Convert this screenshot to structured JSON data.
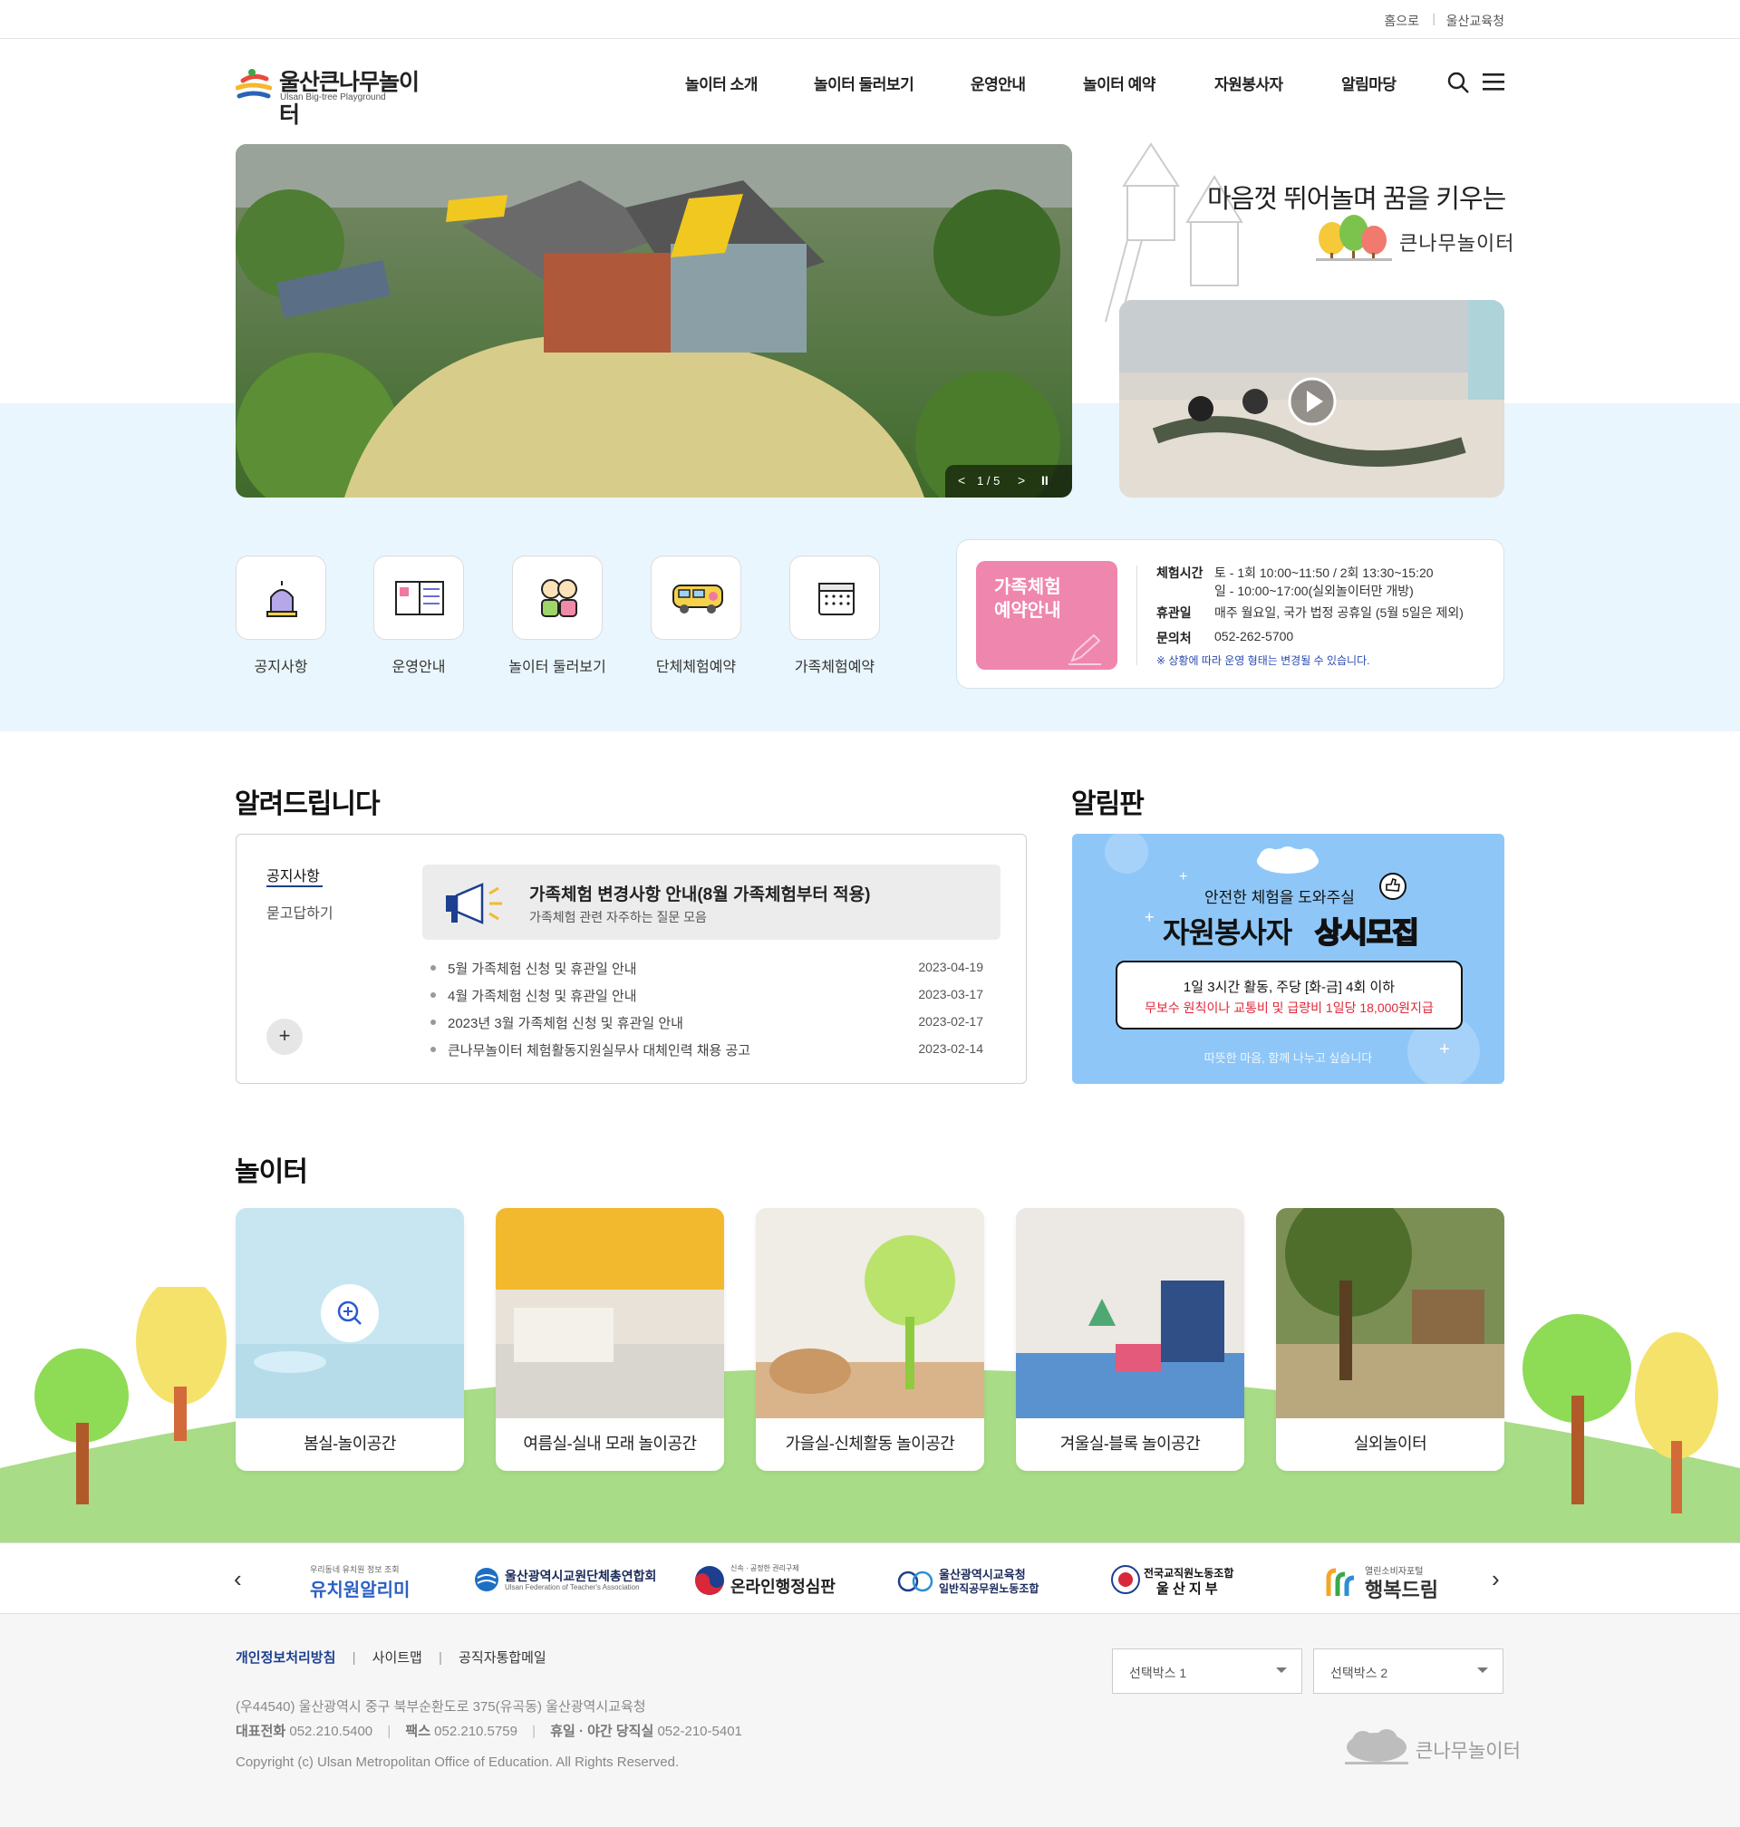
{
  "util": {
    "home": "홈으로",
    "ulsan": "울산교육청"
  },
  "logo": {
    "name": "울산큰나무놀이터",
    "sub": "Ulsan Big-tree Playground"
  },
  "gnb": [
    "놀이터 소개",
    "놀이터 둘러보기",
    "운영안내",
    "놀이터 예약",
    "자원봉사자",
    "알림마당"
  ],
  "hero": {
    "counter": "1 / 5"
  },
  "slogan": {
    "line": "마음껏 뛰어놀며 꿈을 키우는",
    "brand": "큰나무놀이터"
  },
  "quick": [
    "공지사항",
    "운영안내",
    "놀이터 둘러보기",
    "단체체험예약",
    "가족체험예약"
  ],
  "info": {
    "title1": "가족체험",
    "title2": "예약안내",
    "time_label": "체험시간",
    "time1": "토 - 1회 10:00~11:50 / 2회 13:30~15:20",
    "time2": "일 - 10:00~17:00(실외놀이터만 개방)",
    "closed_label": "휴관일",
    "closed": "매주 월요일, 국가 법정 공휴일 (5월 5일은 제외)",
    "contact_label": "문의처",
    "contact": "052-262-5700",
    "note": "※ 상황에 따라 운영 형태는 변경될 수 있습니다."
  },
  "notice": {
    "section_title": "알려드립니다",
    "tab1": "공지사항",
    "tab2": "묻고답하기",
    "feature_title": "가족체험 변경사항 안내(8월 가족체험부터 적용)",
    "feature_sub": "가족체험 관련 자주하는 질문 모음",
    "more": "+",
    "items": [
      {
        "title": "5월 가족체험 신청 및 휴관일 안내",
        "date": "2023-04-19"
      },
      {
        "title": "4월 가족체험 신청 및 휴관일 안내",
        "date": "2023-03-17"
      },
      {
        "title": "2023년 3월 가족체험 신청 및 휴관일 안내",
        "date": "2023-02-17"
      },
      {
        "title": "큰나무놀이터 체험활동지원실무사 대체인력 채용 공고",
        "date": "2023-02-14"
      }
    ]
  },
  "board": {
    "section_title": "알림판",
    "line1": "안전한 체험을 도와주실",
    "line2a": "자원봉사자",
    "line2b": "상시모집",
    "box1": "1일 3시간 활동, 주당 [화-금] 4회 이하",
    "box2": "무보수 원칙이나 교통비 및 급량비 1일당 18,000원지급",
    "footer": "따뜻한 마음, 함께 나누고 싶습니다"
  },
  "play": {
    "section_title": "놀이터",
    "cards": [
      "봄실-놀이공간",
      "여름실-실내 모래 놀이공간",
      "가을실-신체활동 놀이공간",
      "겨울실-블록 놀이공간",
      "실외놀이터"
    ]
  },
  "partners": [
    {
      "small": "우리동네 유치원 정보 조회",
      "name": "유치원알리미"
    },
    {
      "small": "Ulsan Federation of Teacher's Association",
      "name": "울산광역시교원단체총연합회"
    },
    {
      "small": "신속 · 공정한 권리구제",
      "name": "온라인행정심판"
    },
    {
      "small": "일반직공무원노동조합",
      "name": "울산광역시교육청"
    },
    {
      "small": "전국교직원노동조합",
      "name": "울 산 지 부"
    },
    {
      "small": "열린소비자포털",
      "name": "행복드림"
    }
  ],
  "footer": {
    "link1": "개인정보처리방침",
    "link2": "사이트맵",
    "link3": "공직자통합메일",
    "select1": "선택박스 1",
    "select2": "선택박스 2",
    "address": "(우44540) 울산광역시 중구 북부순환도로 375(유곡동) 울산광역시교육청",
    "tel_label": "대표전화",
    "tel": "052.210.5400",
    "fax_label": "팩스",
    "fax": "052.210.5759",
    "night_label": "휴일 · 야간 당직실",
    "night": "052-210-5401",
    "copyright": "Copyright (c) Ulsan Metropolitan Office of Education. All Rights Reserved.",
    "brand": "큰나무놀이터"
  }
}
